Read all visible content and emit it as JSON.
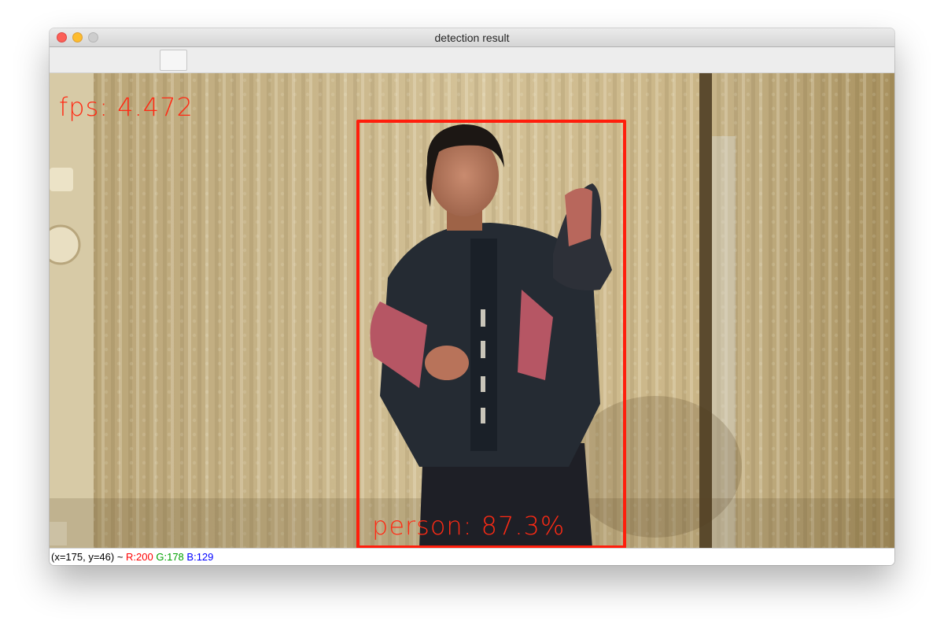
{
  "window": {
    "title": "detection result"
  },
  "overlay": {
    "fps_text": "fps: 4.472",
    "detection_label": "person: 87.3%",
    "box_color": "#ff1e0c"
  },
  "statusbar": {
    "coords": "(x=175, y=46) ~",
    "r": "R:200",
    "g": "G:178",
    "b": "B:129"
  }
}
